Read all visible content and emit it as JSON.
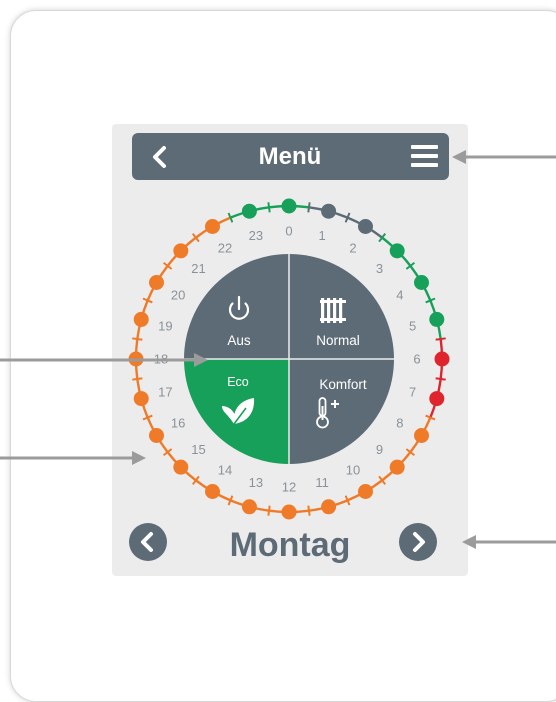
{
  "menu": {
    "title": "Menü",
    "back_icon": "chevron-left-icon",
    "menu_icon": "hamburger-icon"
  },
  "modes": {
    "off_label": "Aus",
    "normal_label": "Normal",
    "eco_label": "Eco",
    "comfort_label": "Komfort",
    "off_icon": "power-icon",
    "normal_icon": "radiator-icon",
    "eco_icon": "leaf-icon",
    "comfort_icon": "thermometer-plus-icon"
  },
  "schedule": {
    "hours": [
      "0",
      "1",
      "2",
      "3",
      "4",
      "5",
      "6",
      "7",
      "8",
      "9",
      "10",
      "11",
      "12",
      "13",
      "14",
      "15",
      "16",
      "17",
      "18",
      "19",
      "20",
      "21",
      "22",
      "23"
    ],
    "hour_modes": [
      "normal",
      "off",
      "off",
      "normal",
      "normal",
      "normal",
      "comfort",
      "comfort",
      "eco",
      "eco",
      "eco",
      "eco",
      "eco",
      "eco",
      "eco",
      "eco",
      "eco",
      "eco",
      "eco",
      "eco",
      "eco",
      "eco",
      "eco",
      "normal"
    ]
  },
  "day": {
    "name": "Montag",
    "prev_icon": "chevron-left-icon",
    "next_icon": "chevron-right-icon"
  },
  "colors": {
    "off": "#5d6b76",
    "normal": "#17a05a",
    "comfort": "#e0242e",
    "eco": "#ef7a28",
    "panel": "#ececec",
    "quad_gray": "#5d6b76",
    "quad_green": "#17a05a",
    "callout": "#9b9b9b"
  }
}
